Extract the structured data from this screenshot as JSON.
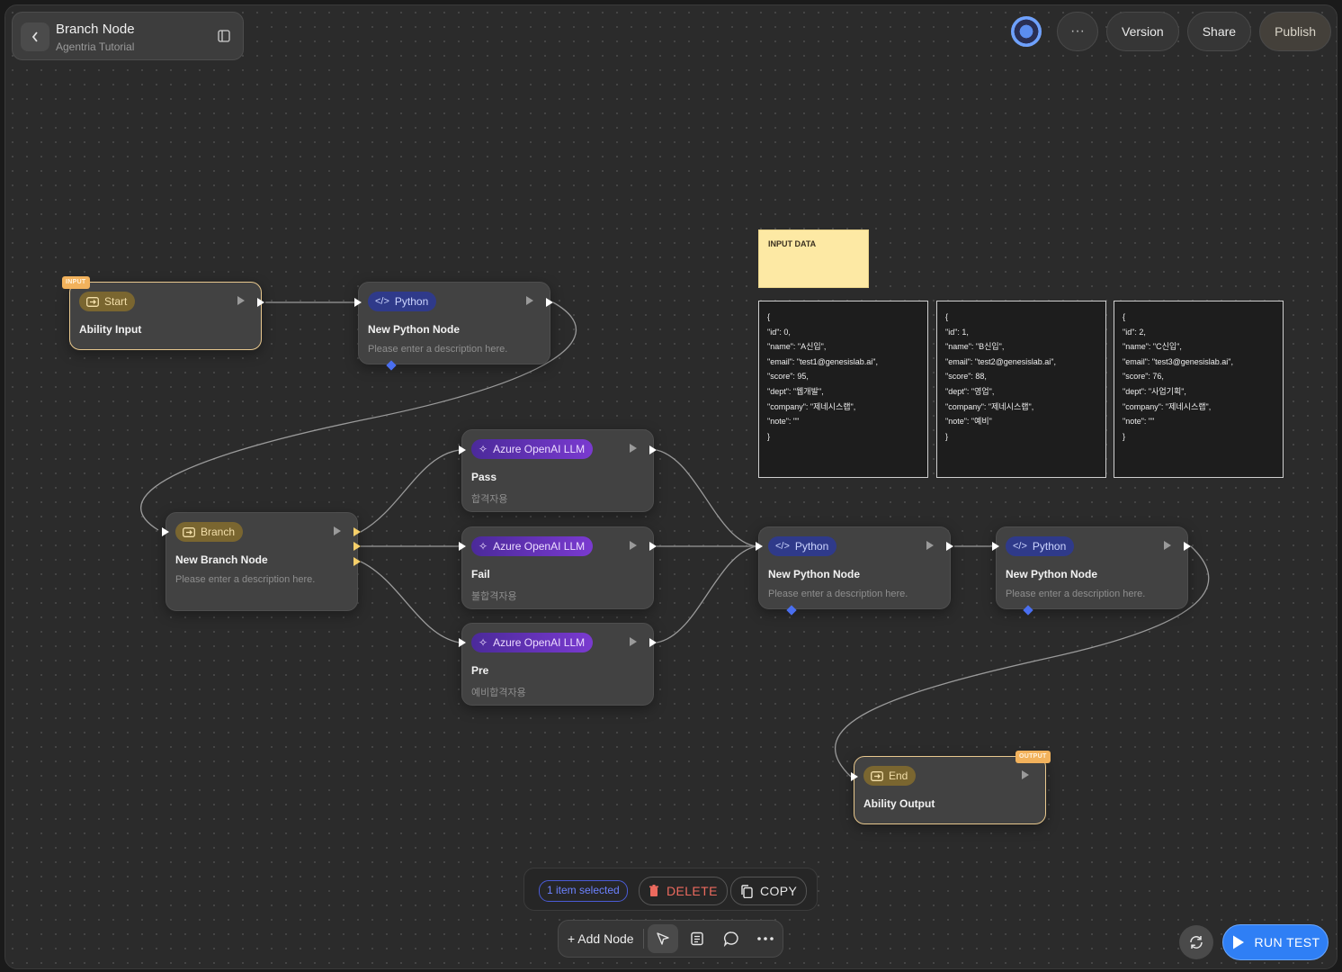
{
  "header": {
    "title": "Branch Node",
    "subtitle": "Agentria Tutorial",
    "more_label": "···",
    "version_label": "Version",
    "share_label": "Share",
    "publish_label": "Publish"
  },
  "nodes": {
    "start": {
      "tag": "INPUT",
      "type": "Start",
      "title": "Ability Input"
    },
    "python1": {
      "type": "Python",
      "title": "New Python Node",
      "desc": "Please enter a description here."
    },
    "branch": {
      "type": "Branch",
      "title": "New Branch Node",
      "desc": "Please enter a description here."
    },
    "llm_pass": {
      "type": "Azure OpenAI LLM",
      "title": "Pass",
      "desc": "합격자용"
    },
    "llm_fail": {
      "type": "Azure OpenAI LLM",
      "title": "Fail",
      "desc": "불합격자용"
    },
    "llm_pre": {
      "type": "Azure OpenAI LLM",
      "title": "Pre",
      "desc": "예비합격자용"
    },
    "python2": {
      "type": "Python",
      "title": "New Python Node",
      "desc": "Please enter a description here."
    },
    "python3": {
      "type": "Python",
      "title": "New Python Node",
      "desc": "Please enter a description here."
    },
    "end": {
      "tag": "OUTPUT",
      "type": "End",
      "title": "Ability Output"
    }
  },
  "sticky_note": {
    "text": "INPUT DATA"
  },
  "code_notes": [
    {
      "lines": [
        "{",
        "\"id\": 0,",
        "\"name\": \"A신입\",",
        "\"email\": \"test1@genesislab.ai\",",
        "\"score\": 95,",
        "\"dept\": \"웹개발\",",
        "\"company\": \"제네시스랩\",",
        "\"note\": \"\"",
        "}"
      ]
    },
    {
      "lines": [
        "{",
        "\"id\": 1,",
        "\"name\": \"B신입\",",
        "\"email\": \"test2@genesislab.ai\",",
        "\"score\": 88,",
        "\"dept\": \"영업\",",
        "\"company\": \"제네시스랩\",",
        "\"note\": \"예비\"",
        "}"
      ]
    },
    {
      "lines": [
        "{",
        "\"id\": 2,",
        "\"name\": \"C신입\",",
        "\"email\": \"test3@genesislab.ai\",",
        "\"score\": 76,",
        "\"dept\": \"사업기획\",",
        "\"company\": \"제네시스랩\",",
        "\"note\": \"\"",
        "}"
      ]
    }
  ],
  "selection": {
    "count_label": "1 item selected",
    "delete_label": "DELETE",
    "copy_label": "COPY"
  },
  "toolbar": {
    "add_node_label": "+ Add Node"
  },
  "run": {
    "label": "RUN TEST"
  },
  "colors": {
    "accent": "#2f7ff5",
    "io_border": "#e8c88e",
    "delete": "#ec6a5e"
  }
}
